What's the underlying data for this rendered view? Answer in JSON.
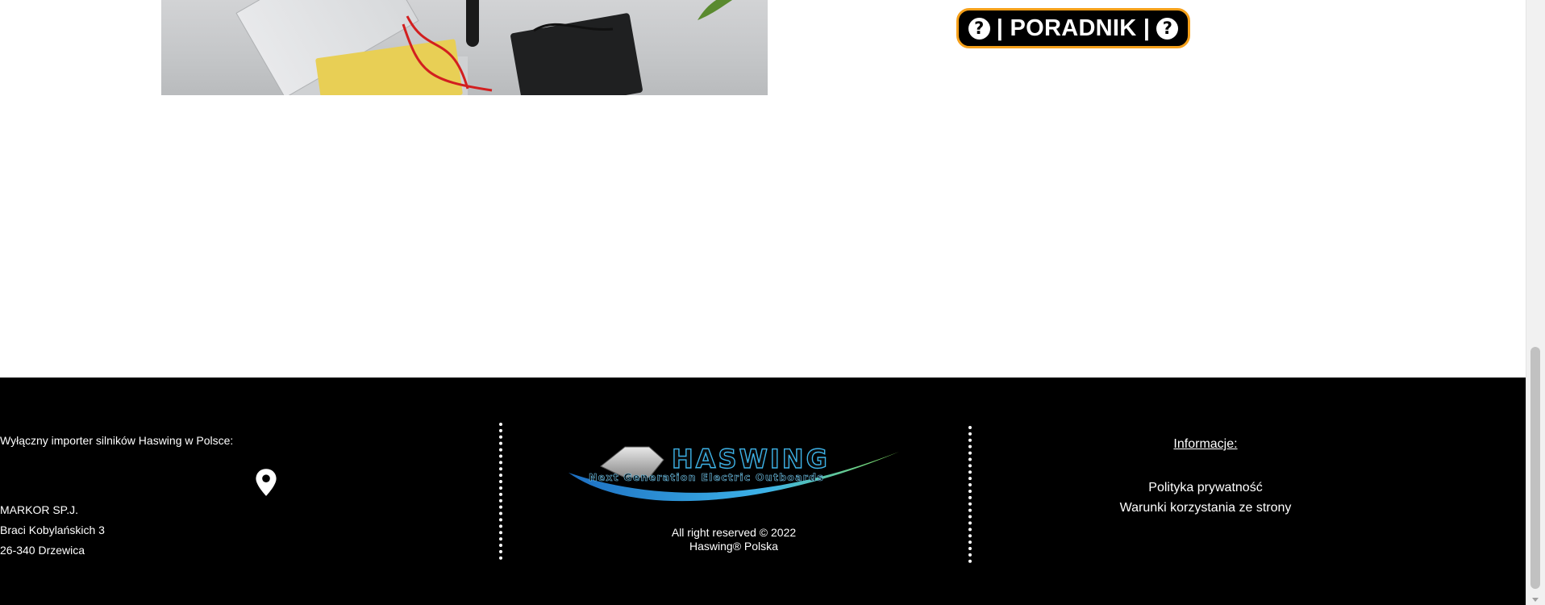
{
  "guide_button": {
    "label": "| PORADNIK |",
    "icon": "question-circle-icon",
    "accent_color": "#f5a01a"
  },
  "footer": {
    "importer_label": "Wyłączny importer silników Haswing w Polsce:",
    "pin_icon": "location-pin-icon",
    "address": {
      "company": "MARKOR SP.J.",
      "street": "Braci Kobylańskich 3",
      "city": "26-340 Drzewica"
    },
    "logo": {
      "brand": "HASWING",
      "tagline": "Next Generation Electric Outboards"
    },
    "rights_line1": "All right reserved © 2022",
    "rights_line2": "Haswing® Polska",
    "info_title": "Informacje:",
    "links": [
      "Polityka prywatność",
      "Warunki korzystania ze strony"
    ]
  }
}
